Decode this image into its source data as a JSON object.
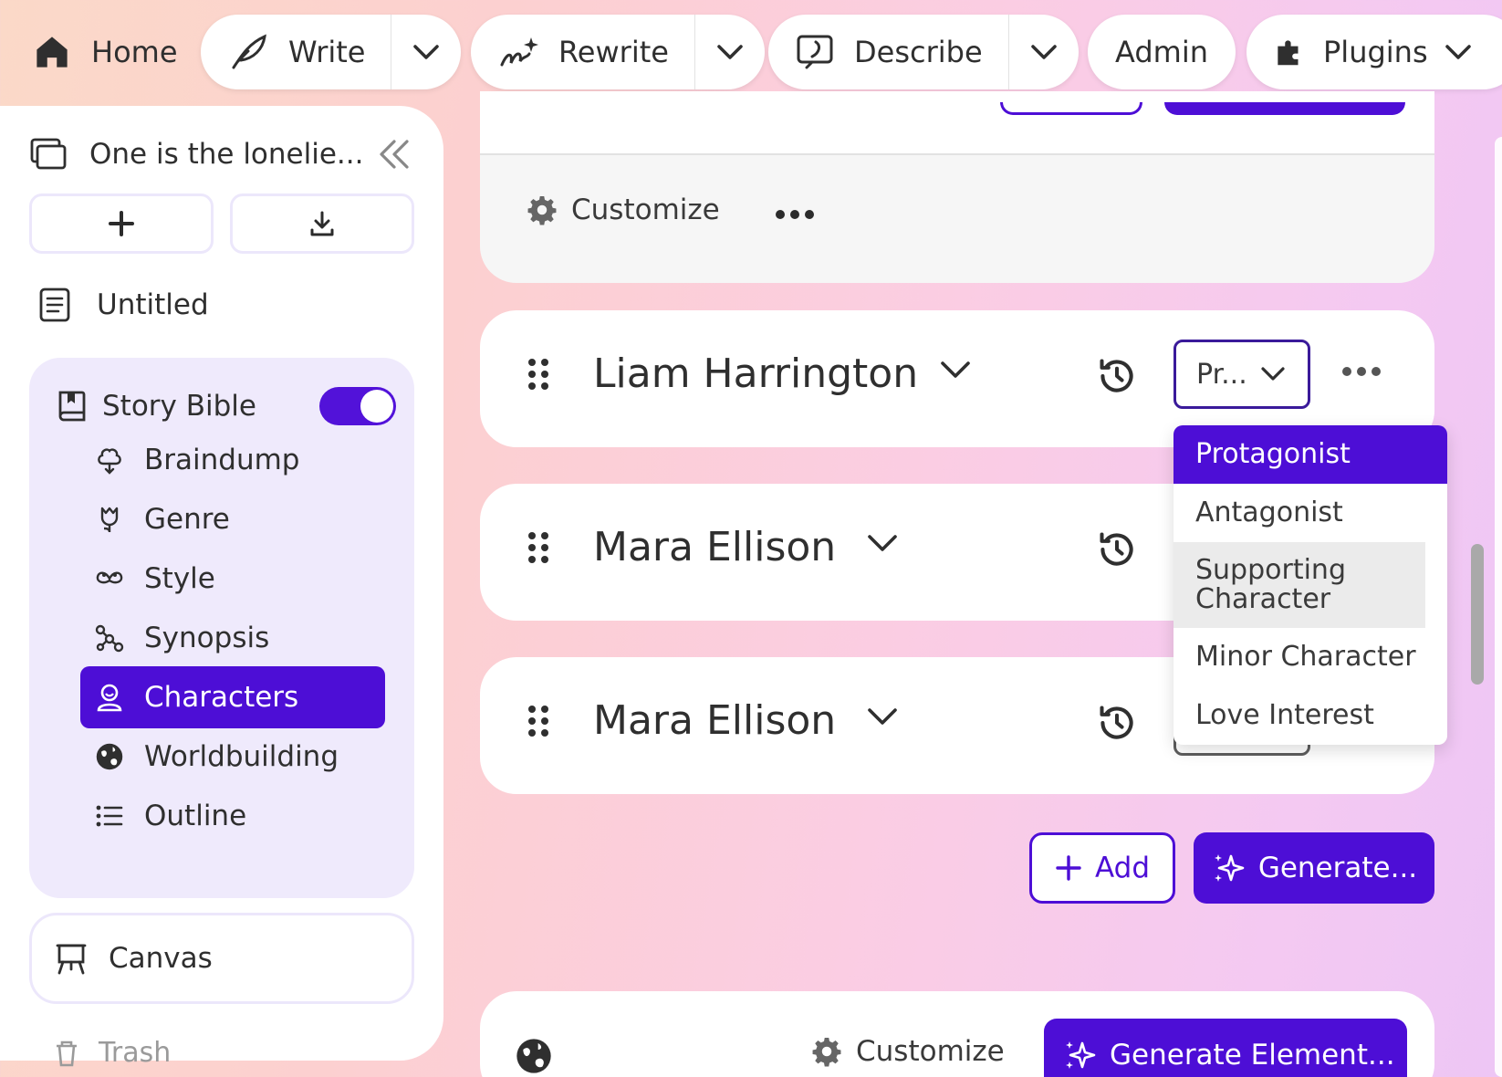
{
  "toolbar": {
    "home_label": "Home",
    "write_label": "Write",
    "rewrite_label": "Rewrite",
    "describe_label": "Describe",
    "admin_label": "Admin",
    "plugins_label": "Plugins"
  },
  "sidebar": {
    "project_title": "One is the lonelie...",
    "document_title": "Untitled",
    "story_bible": {
      "label": "Story Bible",
      "enabled": true,
      "items": [
        {
          "label": "Braindump",
          "icon": "brain-icon"
        },
        {
          "label": "Genre",
          "icon": "tulip-icon"
        },
        {
          "label": "Style",
          "icon": "mustache-icon"
        },
        {
          "label": "Synopsis",
          "icon": "nodes-icon"
        },
        {
          "label": "Characters",
          "icon": "person-icon",
          "active": true
        },
        {
          "label": "Worldbuilding",
          "icon": "globe-icon"
        },
        {
          "label": "Outline",
          "icon": "list-icon"
        }
      ]
    },
    "canvas_label": "Canvas",
    "trash_label": "Trash"
  },
  "main": {
    "customize_label": "Customize",
    "characters": [
      {
        "name": "Liam Harrington",
        "role_display": "Pr..."
      },
      {
        "name": "Mara Ellison"
      },
      {
        "name": "Mara Ellison"
      }
    ],
    "role_options": [
      {
        "label": "Protagonist",
        "state": "selected"
      },
      {
        "label": "Antagonist"
      },
      {
        "label": "Supporting Character",
        "state": "hover"
      },
      {
        "label": "Minor Character"
      },
      {
        "label": "Love Interest"
      }
    ],
    "add_label": "Add",
    "generate_label": "Generate...",
    "bottom": {
      "customize_label": "Customize",
      "generate_element_label": "Generate Element..."
    }
  },
  "colors": {
    "accent": "#4d0ed6",
    "sidebar_panel": "#efeafc"
  }
}
